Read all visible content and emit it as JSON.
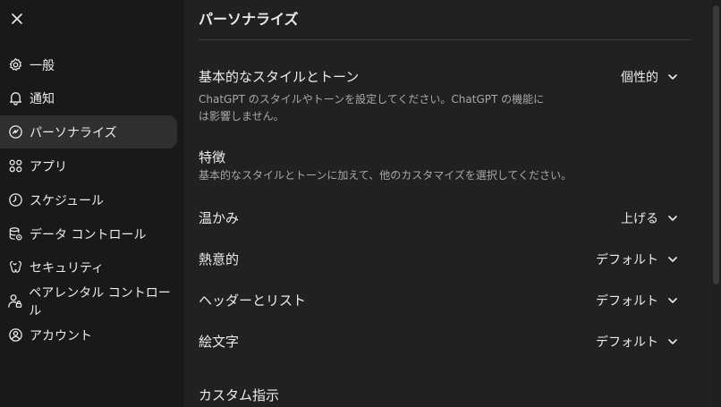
{
  "sidebar": {
    "close_icon": "close-icon",
    "items": [
      {
        "label": "一般",
        "icon": "gear-icon"
      },
      {
        "label": "通知",
        "icon": "bell-icon"
      },
      {
        "label": "パーソナライズ",
        "icon": "personalize-icon",
        "active": true
      },
      {
        "label": "アプリ",
        "icon": "apps-icon"
      },
      {
        "label": "スケジュール",
        "icon": "clock-icon"
      },
      {
        "label": "データ コントロール",
        "icon": "database-gear-icon"
      },
      {
        "label": "セキュリティ",
        "icon": "security-icon"
      },
      {
        "label": "ペアレンタル コントロール",
        "icon": "person-lock-icon"
      },
      {
        "label": "アカウント",
        "icon": "account-icon"
      }
    ]
  },
  "main": {
    "title": "パーソナライズ",
    "base_style": {
      "label": "基本的なスタイルとトーン",
      "value": "個性的",
      "description_line1": "ChatGPT のスタイルやトーンを設定してください。ChatGPT の機能に",
      "description_line2": "は影響しません。"
    },
    "features": {
      "label": "特徴",
      "description": "基本的なスタイルとトーンに加えて、他のカスタマイズを選択してください。"
    },
    "settings": [
      {
        "label": "温かみ",
        "value": "上げる"
      },
      {
        "label": "熱意的",
        "value": "デフォルト"
      },
      {
        "label": "ヘッダーとリスト",
        "value": "デフォルト"
      },
      {
        "label": "絵文字",
        "value": "デフォルト"
      }
    ],
    "custom_instructions": {
      "label": "カスタム指示"
    }
  },
  "colors": {
    "sidebar_bg": "#191919",
    "main_bg": "#212121",
    "active_item_bg": "#2f2f2f",
    "text": "#ececec",
    "muted_text": "#a8a8a8"
  }
}
